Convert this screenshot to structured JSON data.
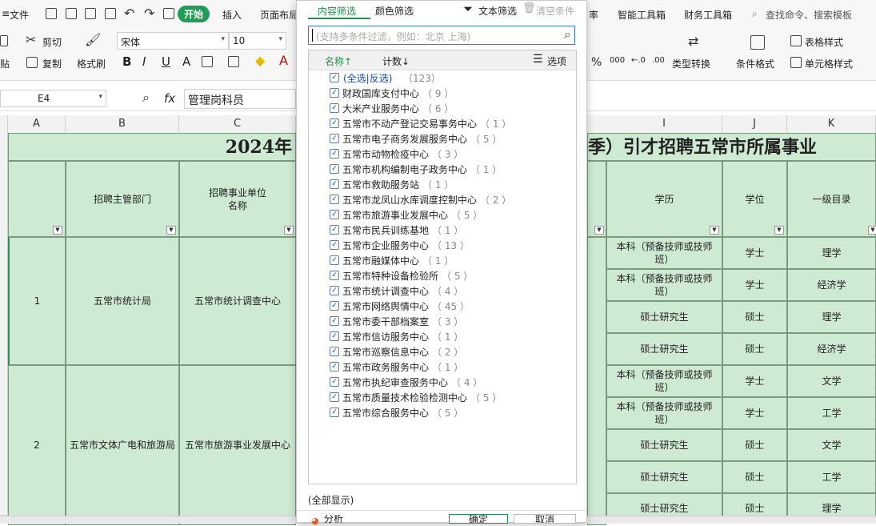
{
  "ribbon": {
    "menu_file": "文件",
    "tab_start": "开始",
    "tab_insert": "插入",
    "tab_layout": "页面布局",
    "tab_rate": "率",
    "tab_tools": "智能工具箱",
    "tab_finance": "财务工具箱",
    "search_placeholder": "查找命令、搜索模板",
    "cut": "剪切",
    "paste": "贴",
    "copy": "复制",
    "format_painter": "格式刷",
    "font_name": "宋体",
    "font_size": "10",
    "bold": "B",
    "italic": "I",
    "underline": "U",
    "strike": "A",
    "percent": "%",
    "thousands": "000",
    "dec_inc": "←.0",
    "dec_dec": ".00",
    "type_convert": "类型转换",
    "cond_format": "条件格式",
    "table_style": "表格样式",
    "cell_style": "单元格样式"
  },
  "formula": {
    "name_box": "E4",
    "fx": "fx",
    "value": "管理岗科员"
  },
  "columns": [
    "A",
    "B",
    "C",
    "I",
    "J",
    "K"
  ],
  "sheet": {
    "title_left": "2024年",
    "title_right": "季）引才招聘五常市所属事业",
    "hdr_dept": "招聘主管部门",
    "hdr_unit": "招聘事业单位\n名称",
    "hdr_edu": "学历",
    "hdr_degree": "学位",
    "hdr_dir": "一级目录",
    "row1_no": "1",
    "row1_dept": "五常市统计局",
    "row1_unit": "五常市统计调查中心",
    "row2_no": "2",
    "row2_dept": "五常市文体广电和旅游局",
    "row2_unit": "五常市旅游事业发展中心",
    "rows": [
      {
        "edu": "本科（预备技师或技师班）",
        "degree": "学士",
        "dir": "理学"
      },
      {
        "edu": "本科（预备技师或技师班）",
        "degree": "学士",
        "dir": "经济学"
      },
      {
        "edu": "硕士研究生",
        "degree": "硕士",
        "dir": "理学"
      },
      {
        "edu": "硕士研究生",
        "degree": "硕士",
        "dir": "经济学"
      },
      {
        "edu": "本科（预备技师或技师班）",
        "degree": "学士",
        "dir": "文学"
      },
      {
        "edu": "本科（预备技师或技师班）",
        "degree": "学士",
        "dir": "工学"
      },
      {
        "edu": "硕士研究生",
        "degree": "硕士",
        "dir": "文学"
      },
      {
        "edu": "硕士研究生",
        "degree": "硕士",
        "dir": "工学"
      },
      {
        "edu": "硕士研究生",
        "degree": "硕士",
        "dir": "理学"
      }
    ]
  },
  "filter": {
    "tab_content": "内容筛选",
    "tab_color": "颜色筛选",
    "text_filter": "文本筛选",
    "clear": "清空条件",
    "search_placeholder": "(支持多条件过滤，例如：北京  上海)",
    "sort_name": "名称↑",
    "sort_count": "计数↓",
    "options": "选项",
    "select_all": "(全选|反选)",
    "select_all_count": "（123）",
    "items": [
      {
        "name": "财政国库支付中心",
        "count": "（ 9 ）"
      },
      {
        "name": "大米产业服务中心",
        "count": "（ 6 ）"
      },
      {
        "name": "五常市不动产登记交易事务中心",
        "count": "（ 1 ）"
      },
      {
        "name": "五常市电子商务发展服务中心",
        "count": "（ 5 ）"
      },
      {
        "name": "五常市动物检疫中心",
        "count": "（ 3 ）"
      },
      {
        "name": "五常市机构编制电子政务中心",
        "count": "（ 1 ）"
      },
      {
        "name": "五常市救助服务站",
        "count": "（ 1 ）"
      },
      {
        "name": "五常市龙凤山水库调度控制中心",
        "count": "（ 2 ）"
      },
      {
        "name": "五常市旅游事业发展中心",
        "count": "（ 5 ）"
      },
      {
        "name": "五常市民兵训练基地",
        "count": "（ 1 ）"
      },
      {
        "name": "五常市企业服务中心",
        "count": "（ 13 ）"
      },
      {
        "name": "五常市融媒体中心",
        "count": "（ 1 ）"
      },
      {
        "name": "五常市特种设备检验所",
        "count": "（ 5 ）"
      },
      {
        "name": "五常市统计调查中心",
        "count": "（ 4 ）"
      },
      {
        "name": "五常市网络舆情中心",
        "count": "（ 45 ）"
      },
      {
        "name": "五常市委干部档案室",
        "count": "（ 3 ）"
      },
      {
        "name": "五常市信访服务中心",
        "count": "（ 1 ）"
      },
      {
        "name": "五常市巡察信息中心",
        "count": "（ 2 ）"
      },
      {
        "name": "五常市政务服务中心",
        "count": "（ 1 ）"
      },
      {
        "name": "五常市执纪审查服务中心",
        "count": "（ 4 ）"
      },
      {
        "name": "五常市质量技术检验检测中心",
        "count": "（ 5 ）"
      },
      {
        "name": "五常市综合服务中心",
        "count": "（ 5 ）"
      }
    ],
    "show_all": "(全部显示)",
    "analysis": "分析",
    "ok": "确定",
    "cancel": "取消"
  }
}
